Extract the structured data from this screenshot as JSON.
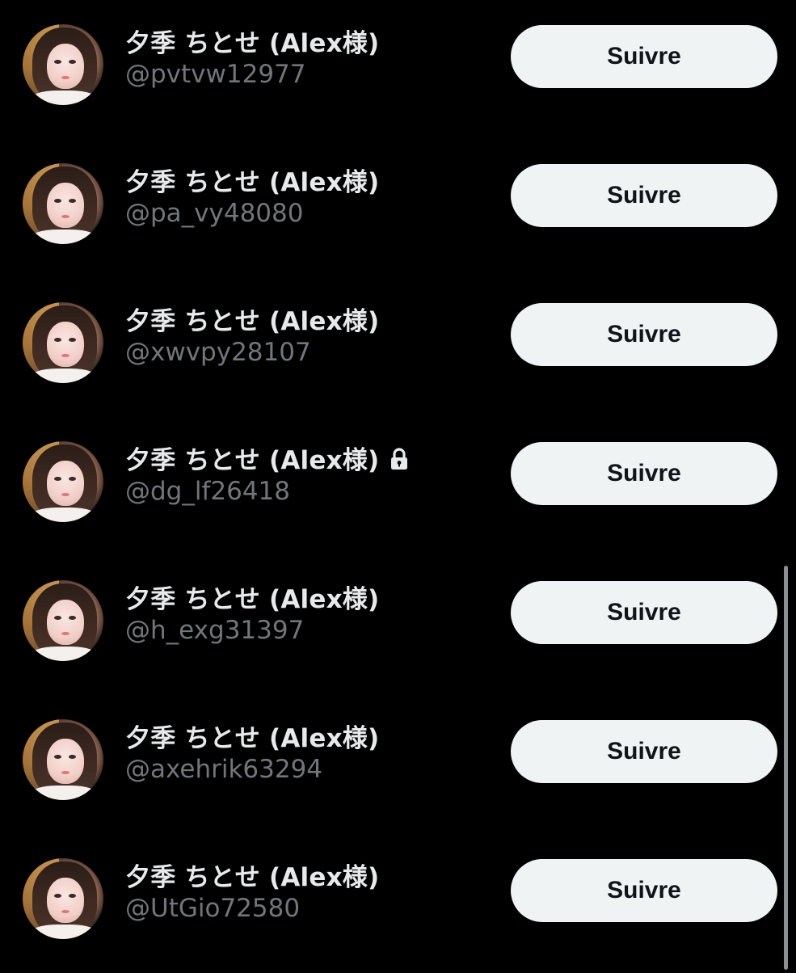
{
  "follow_label": "Suivre",
  "users": [
    {
      "display_name": "夕季 ちとせ (Alex様)",
      "handle": "@pvtvw12977",
      "protected": false
    },
    {
      "display_name": "夕季 ちとせ (Alex様)",
      "handle": "@pa_vy48080",
      "protected": false
    },
    {
      "display_name": "夕季 ちとせ (Alex様)",
      "handle": "@xwvpy28107",
      "protected": false
    },
    {
      "display_name": "夕季 ちとせ (Alex様)",
      "handle": "@dg_lf26418",
      "protected": true,
      "badge_icon": "lock-icon"
    },
    {
      "display_name": "夕季 ちとせ (Alex様)",
      "handle": "@h_exg31397",
      "protected": false
    },
    {
      "display_name": "夕季 ちとせ (Alex様)",
      "handle": "@axehrik63294",
      "protected": false
    },
    {
      "display_name": "夕季 ちとせ (Alex様)",
      "handle": "@UtGio72580",
      "protected": false
    }
  ],
  "colors": {
    "background": "#000000",
    "name": "#e7e9ea",
    "handle": "#71767b",
    "button_bg": "#eff3f4",
    "button_text": "#0f1419"
  }
}
